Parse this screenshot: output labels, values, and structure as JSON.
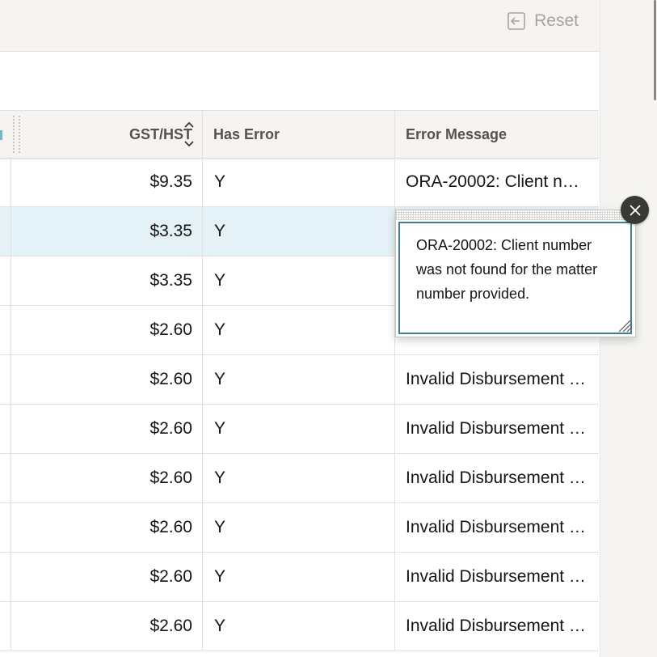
{
  "toolbar": {
    "reset_label": "Reset",
    "reset_icon": "reset-icon"
  },
  "grid": {
    "columns": {
      "gst": "GST/HST",
      "has_error": "Has Error",
      "error_message": "Error Message"
    },
    "rows": [
      {
        "gst": "$9.35",
        "has_error": "Y",
        "error_message": "ORA-20002: Client n…"
      },
      {
        "gst": "$3.35",
        "has_error": "Y",
        "error_message": ""
      },
      {
        "gst": "$3.35",
        "has_error": "Y",
        "error_message": ""
      },
      {
        "gst": "$2.60",
        "has_error": "Y",
        "error_message": ""
      },
      {
        "gst": "$2.60",
        "has_error": "Y",
        "error_message": "Invalid Disbursement …"
      },
      {
        "gst": "$2.60",
        "has_error": "Y",
        "error_message": "Invalid Disbursement …"
      },
      {
        "gst": "$2.60",
        "has_error": "Y",
        "error_message": "Invalid Disbursement …"
      },
      {
        "gst": "$2.60",
        "has_error": "Y",
        "error_message": "Invalid Disbursement …"
      },
      {
        "gst": "$2.60",
        "has_error": "Y",
        "error_message": "Invalid Disbursement …"
      },
      {
        "gst": "$2.60",
        "has_error": "Y",
        "error_message": "Invalid Disbursement …"
      }
    ]
  },
  "popup": {
    "text": "ORA-20002: Client number was not found for the matter number provided.",
    "close_icon": "close-icon"
  },
  "colors": {
    "selected_row": "#e4f1f7",
    "accent": "#3f7f91"
  }
}
